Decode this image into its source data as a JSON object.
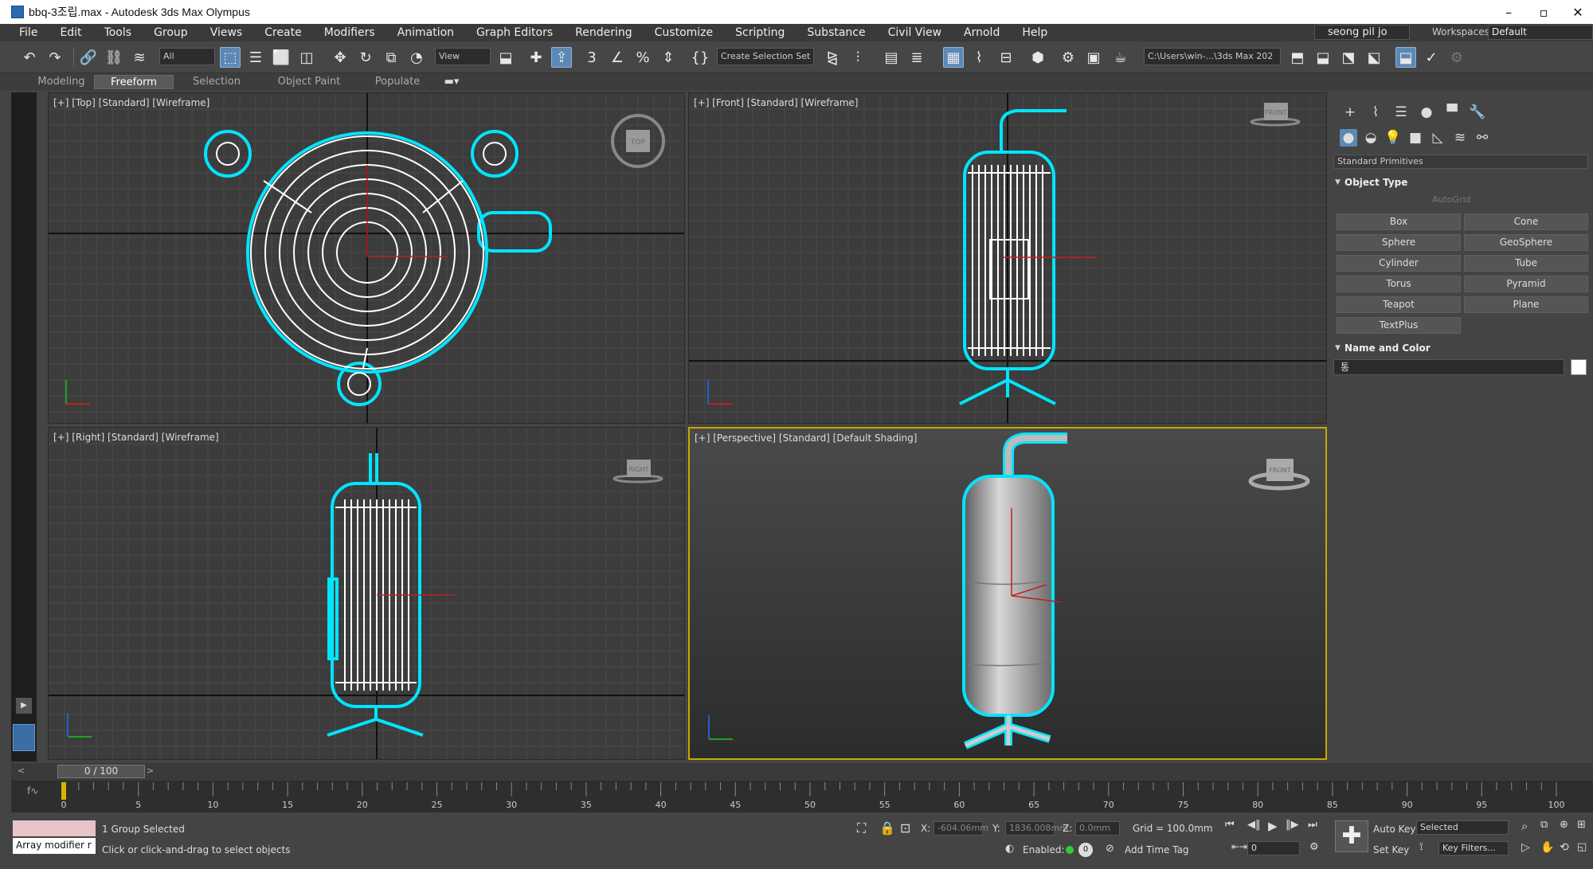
{
  "window": {
    "title": "bbq-3조립.max - Autodesk 3ds Max Olympus",
    "min": "–",
    "restore": "▫",
    "close": "✕"
  },
  "menu": [
    "File",
    "Edit",
    "Tools",
    "Group",
    "Views",
    "Create",
    "Modifiers",
    "Animation",
    "Graph Editors",
    "Rendering",
    "Customize",
    "Scripting",
    "Substance",
    "Civil View",
    "Arnold",
    "Help"
  ],
  "user": "seong pil jo",
  "workspaces_label": "Workspaces:",
  "workspace": "Default",
  "toolbar": {
    "filter": "All",
    "refcoord": "View",
    "selection_set": "Create Selection Set",
    "path": "C:\\Users\\win-...\\3ds Max 202"
  },
  "ribbon": {
    "tabs": [
      "Modeling",
      "Freeform",
      "Selection",
      "Object Paint",
      "Populate"
    ],
    "active": "Freeform"
  },
  "viewports": {
    "top": "[+] [Top] [Standard] [Wireframe]",
    "front": "[+] [Front] [Standard] [Wireframe]",
    "right": "[+] [Right] [Standard] [Wireframe]",
    "perspective": "[+] [Perspective] [Standard] [Default Shading]",
    "cube_top": "TOP",
    "cube_front": "FRONT",
    "cube_right": "RIGHT",
    "cube_persp": "FRONT"
  },
  "command_panel": {
    "category": "Standard Primitives",
    "object_type": "Object Type",
    "autogrid": "AutoGrid",
    "buttons": [
      "Box",
      "Cone",
      "Sphere",
      "GeoSphere",
      "Cylinder",
      "Tube",
      "Torus",
      "Pyramid",
      "Teapot",
      "Plane",
      "TextPlus"
    ],
    "name_and_color": "Name and Color",
    "name_value": "통"
  },
  "timeline": {
    "frame": "0 / 100",
    "ticks": [
      "0",
      "5",
      "10",
      "15",
      "20",
      "25",
      "30",
      "35",
      "40",
      "45",
      "50",
      "55",
      "60",
      "65",
      "70",
      "75",
      "80",
      "85",
      "90",
      "95",
      "100"
    ]
  },
  "status": {
    "modifier": "Array modifier r",
    "selected": "1 Group Selected",
    "prompt": "Click or click-and-drag to select objects",
    "x_label": "X:",
    "x_value": "-604.06mm",
    "y_label": "Y:",
    "y_value": "1836.008mm",
    "z_label": "Z:",
    "z_value": "0.0mm",
    "grid": "Grid = 100.0mm",
    "enabled": "Enabled:",
    "add_time_tag": "Add Time Tag",
    "auto_key": "Auto Key",
    "auto_key_mode": "Selected",
    "set_key": "Set Key",
    "key_filters": "Key Filters...",
    "frame_field": "0"
  },
  "colors": {
    "accent": "#5c88b6",
    "selection": "#00e5ff",
    "active_viewport": "#c8a800"
  }
}
